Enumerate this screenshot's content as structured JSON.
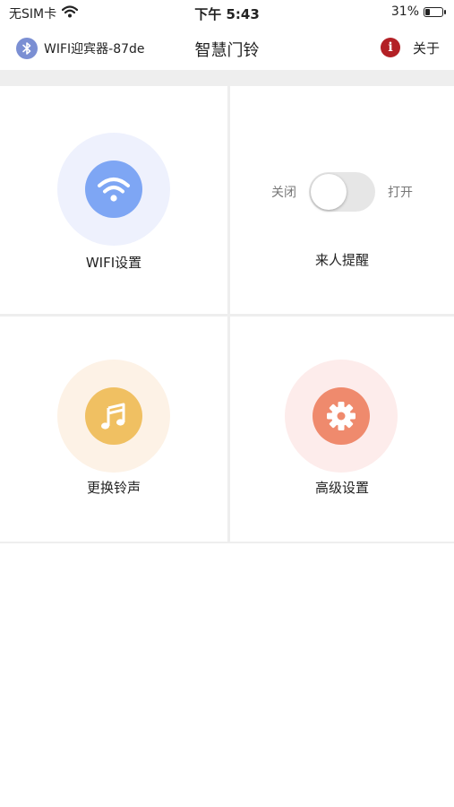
{
  "status_bar": {
    "carrier": "无SIM卡",
    "time": "下午 5:43",
    "battery": "31%",
    "battery_level": 0.31
  },
  "nav": {
    "device_name": "WIFI迎宾器-87de",
    "title": "智慧门铃",
    "about_label": "关于"
  },
  "tiles": {
    "wifi": {
      "label": "WIFI设置",
      "icon": "wifi-icon",
      "halo_color": "#eef1fd",
      "icon_color": "#7ea6f4"
    },
    "visitor_alert": {
      "label": "来人提醒",
      "toggle_off_label": "关闭",
      "toggle_on_label": "打开",
      "enabled": false
    },
    "ringtone": {
      "label": "更换铃声",
      "icon": "music-note-icon",
      "halo_color": "#fdf2e6",
      "icon_color": "#f0c062"
    },
    "advanced": {
      "label": "高级设置",
      "icon": "gear-icon",
      "halo_color": "#fdeceb",
      "icon_color": "#ef8a6d"
    }
  },
  "colors": {
    "bluetooth": "#7b8fd3",
    "info": "#b32025"
  }
}
